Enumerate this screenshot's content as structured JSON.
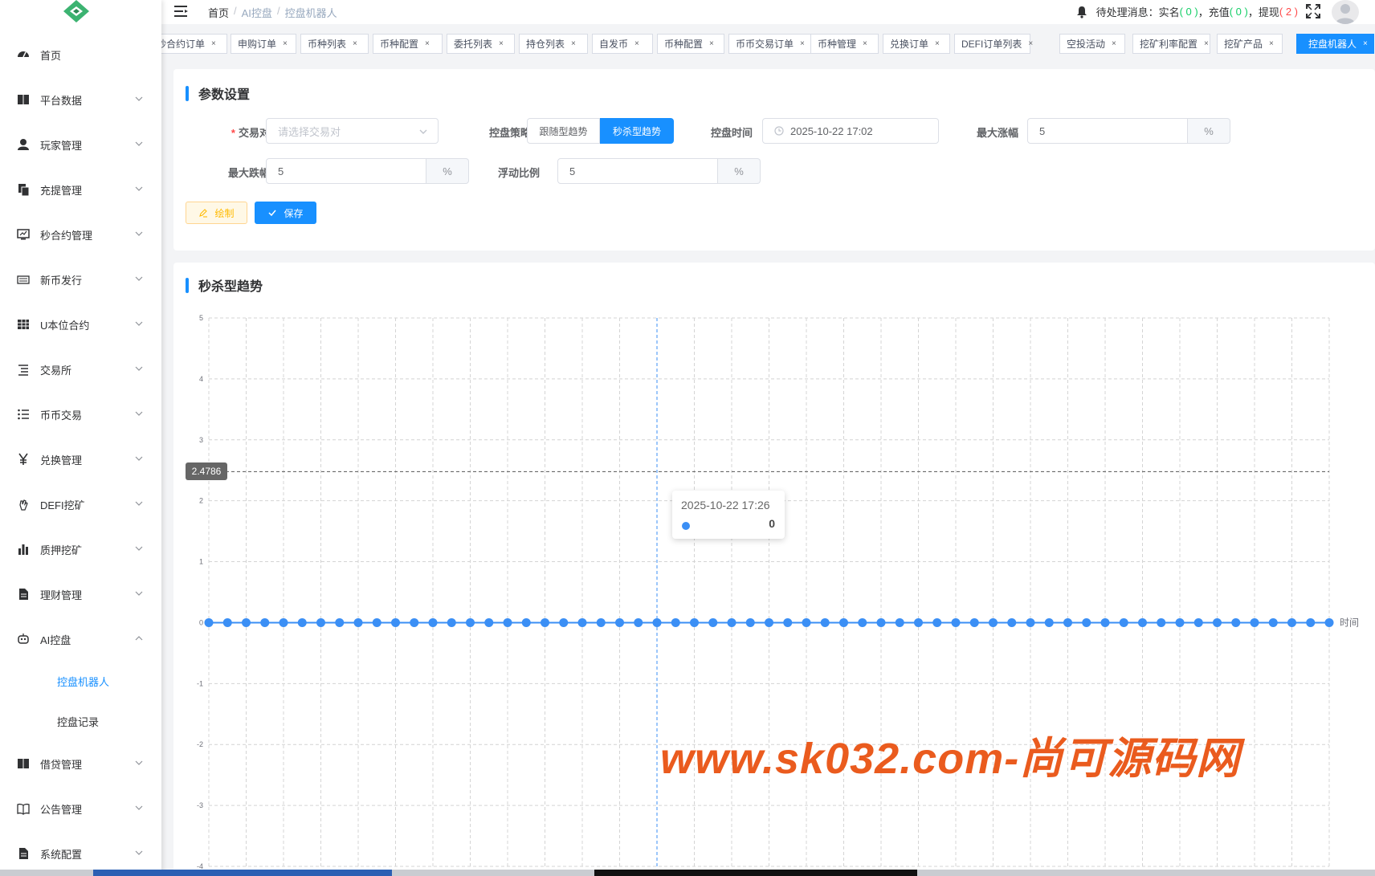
{
  "sidebar": {
    "items": [
      {
        "label": "首页",
        "icon": "dashboard-icon",
        "arrow": ""
      },
      {
        "label": "平台数据",
        "icon": "book-icon",
        "arrow": "down"
      },
      {
        "label": "玩家管理",
        "icon": "user-icon",
        "arrow": "down"
      },
      {
        "label": "充提管理",
        "icon": "copy-icon",
        "arrow": "down"
      },
      {
        "label": "秒合约管理",
        "icon": "monitor-icon",
        "arrow": "down"
      },
      {
        "label": "新币发行",
        "icon": "keyboard-icon",
        "arrow": "down"
      },
      {
        "label": "U本位合约",
        "icon": "table-icon",
        "arrow": "down"
      },
      {
        "label": "交易所",
        "icon": "tree-list-icon",
        "arrow": "down"
      },
      {
        "label": "币币交易",
        "icon": "list-icon",
        "arrow": "down"
      },
      {
        "label": "兑换管理",
        "icon": "yen-icon",
        "arrow": "down"
      },
      {
        "label": "DEFI挖矿",
        "icon": "hand-icon",
        "arrow": "down"
      },
      {
        "label": "质押挖矿",
        "icon": "bar-chart-icon",
        "arrow": "down"
      },
      {
        "label": "理财管理",
        "icon": "document-icon",
        "arrow": "down"
      },
      {
        "label": "AI控盘",
        "icon": "robot-icon",
        "arrow": "up"
      }
    ],
    "subitems": [
      {
        "label": "控盘机器人",
        "active": true
      },
      {
        "label": "控盘记录",
        "active": false
      }
    ],
    "items_bottom": [
      {
        "label": "借贷管理",
        "icon": "book-icon",
        "arrow": "down"
      },
      {
        "label": "公告管理",
        "icon": "open-book-icon",
        "arrow": "down"
      },
      {
        "label": "系统配置",
        "icon": "document-icon",
        "arrow": "down"
      }
    ]
  },
  "header": {
    "breadcrumb": [
      "首页",
      "AI控盘",
      "控盘机器人"
    ],
    "breadcrumb_sep": "/",
    "notify": {
      "prefix": "待处理消息：实名",
      "real_name_count": "( 0 )",
      "recharge_label": "，充值",
      "recharge_count": "( 0 )",
      "withdraw_label": "，提现",
      "withdraw_count": "( 2 )"
    }
  },
  "tags": [
    {
      "label": "秒合约订单",
      "active": false
    },
    {
      "label": "申购订单",
      "active": false
    },
    {
      "label": "币种列表",
      "active": false
    },
    {
      "label": "币种配置",
      "active": false
    },
    {
      "label": "委托列表",
      "active": false
    },
    {
      "label": "持仓列表",
      "active": false
    },
    {
      "label": "自发币",
      "active": false
    },
    {
      "label": "币种配置",
      "active": false
    },
    {
      "label": "币币交易订单",
      "active": false
    },
    {
      "label": "币种管理",
      "active": false
    },
    {
      "label": "兑换订单",
      "active": false
    },
    {
      "label": "DEFI订单列表",
      "active": false
    },
    {
      "label": "空投活动",
      "active": false
    },
    {
      "label": "挖矿利率配置",
      "active": false
    },
    {
      "label": "挖矿产品",
      "active": false
    },
    {
      "label": "控盘机器人",
      "active": true
    }
  ],
  "tag_close": "×",
  "params": {
    "title": "参数设置",
    "pair_label": "交易对",
    "pair_required": "*",
    "pair_placeholder": "请选择交易对",
    "strategy_label": "控盘策略",
    "strategy_options": [
      "跟随型趋势",
      "秒杀型趋势"
    ],
    "strategy_selected": "秒杀型趋势",
    "time_label": "控盘时间",
    "time_value": "2025-10-22 17:02",
    "max_rise_label": "最大涨幅",
    "max_rise_value": "5",
    "max_fall_label": "最大跌幅",
    "max_fall_value": "5",
    "float_label": "浮动比例",
    "float_value": "5",
    "percent": "%",
    "draw_button": "绘制",
    "save_button": "保存"
  },
  "chart_card": {
    "title": "秒杀型趋势",
    "tooltip_time": "2025-10-22 17:26",
    "tooltip_value": "0",
    "y_pointer_value": "2.4786"
  },
  "chart_data": {
    "type": "line",
    "title": "",
    "xlabel": "时间",
    "ylabel": "",
    "x_axis": "time, 2025-10-22 17:02 to 17:62 at 1-minute steps (ticks unlabeled)",
    "ylim": [
      -4,
      5
    ],
    "yticks": [
      5,
      4,
      3,
      2,
      1,
      0,
      -1,
      -2,
      -3,
      -4
    ],
    "series": [
      {
        "name": "",
        "color": "#3b8ff5",
        "values": [
          0,
          0,
          0,
          0,
          0,
          0,
          0,
          0,
          0,
          0,
          0,
          0,
          0,
          0,
          0,
          0,
          0,
          0,
          0,
          0,
          0,
          0,
          0,
          0,
          0,
          0,
          0,
          0,
          0,
          0,
          0,
          0,
          0,
          0,
          0,
          0,
          0,
          0,
          0,
          0,
          0,
          0,
          0,
          0,
          0,
          0,
          0,
          0,
          0,
          0,
          0,
          0,
          0,
          0,
          0,
          0,
          0,
          0,
          0,
          0,
          0
        ]
      }
    ],
    "highlight_index": 24,
    "grid": true
  },
  "watermark": "www.sk032.com-尚可源码网",
  "colors": {
    "accent": "#1890ff",
    "series": "#3b8ff5",
    "warning": "#ffba00",
    "watermark": "#ea5b1e"
  }
}
